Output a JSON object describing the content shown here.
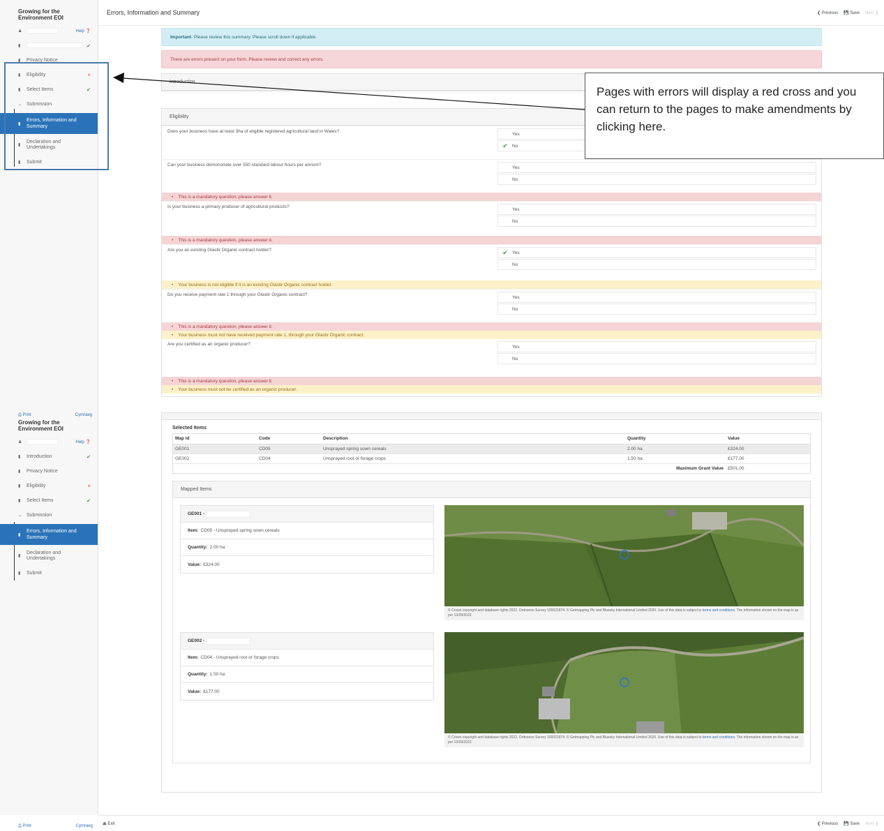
{
  "app_title": "Growing for the Environment EOI",
  "page_title": "Errors, Information and Summary",
  "nav": {
    "previous": "Previous",
    "save": "Save",
    "next": "Next"
  },
  "footer": {
    "exit": "Exit"
  },
  "sidebar": {
    "help": "Help",
    "print": "Print",
    "language": "Cymraeg",
    "items": [
      {
        "label": "Introduction",
        "status": "complete"
      },
      {
        "label": "Privacy Notice",
        "status": ""
      },
      {
        "label": "Eligibility",
        "status": "error"
      },
      {
        "label": "Select Items",
        "status": "complete"
      },
      {
        "label": "Submission",
        "status": ""
      },
      {
        "label": "Errors, Information and Summary",
        "status": ""
      },
      {
        "label": "Declaration and Undertakings",
        "status": ""
      },
      {
        "label": "Submit",
        "status": ""
      }
    ]
  },
  "alerts": {
    "important_strong": "Important",
    "important_text": " - Please review this summary. Please scroll down if applicable.",
    "errors": "There are errors present on your form. Please review and correct any errors."
  },
  "sections": {
    "introduction": "Introduction",
    "eligibility": "Eligibility"
  },
  "options": {
    "yes": "Yes",
    "no": "No"
  },
  "questions": [
    {
      "text": "Does your business have at least 3ha of eligible registered agricultural land in Wales?",
      "selected": "No"
    },
    {
      "text": "Can your business demonstrate over 550 standard labour hours per annum?",
      "selected": ""
    },
    {
      "text": "Is your business a primary producer of agricultural products?",
      "selected": ""
    },
    {
      "text": "Are you an existing Glastir Organic contract holder?",
      "selected": "Yes"
    },
    {
      "text": "Do you receive payment rate 1 through your Glastir Organic contract?",
      "selected": ""
    },
    {
      "text": "Are you certified as an organic producer?",
      "selected": ""
    }
  ],
  "messages": {
    "mandatory": "This is a mandatory question, please answer it.",
    "glastir_holder": "Your business is not eligible if it is an existing Glastir Organic contract holder.",
    "payment_rate": "Your business must not have received payment rate 1, through your Glastir Organic contract.",
    "organic": "Your business must not be certified as an organic producer."
  },
  "selected_items": {
    "title": "Selected Items",
    "columns": [
      "Map Id",
      "Code",
      "Description",
      "Quantity",
      "Value"
    ],
    "rows": [
      [
        "GE001",
        "CD05",
        "Unsprayed spring sown cereals",
        "2.00 ha",
        "£324.00"
      ],
      [
        "GE002",
        "CD04",
        "Unsprayed root or forage crops",
        "1.50 ha",
        "£177.00"
      ]
    ],
    "max_label": "Maximum Grant Value",
    "max_value": "£501.00"
  },
  "mapped_items": {
    "title": "Mapped Items",
    "item_label": "Item:",
    "quantity_label": "Quantity:",
    "value_label": "Value:",
    "items": [
      {
        "id": "GE001 -",
        "item": "CD05 - Unsprayed spring sown cereals",
        "quantity": "2.00 ha",
        "value": "£324.00"
      },
      {
        "id": "GE002 -",
        "item": "CD04 - Unsprayed root or forage crops",
        "quantity": "1.50 ha",
        "value": "£177.00"
      }
    ],
    "copyright": "© Crown copyright and database rights 2022. Ordnance Survey 100021874. © Getmapping Plc and Bluesky International Limited 2020. Use of this data is subject to",
    "terms_link": "terms and conditions",
    "copyright_end": ". The information shown on the map is as per 13/09/2022."
  },
  "callout": "Pages with errors will display a red cross and you can return to the pages to make amendments by clicking here.",
  "colors": {
    "accent": "#2a73b8",
    "error": "#d9534f",
    "success": "#2c9c2c"
  }
}
